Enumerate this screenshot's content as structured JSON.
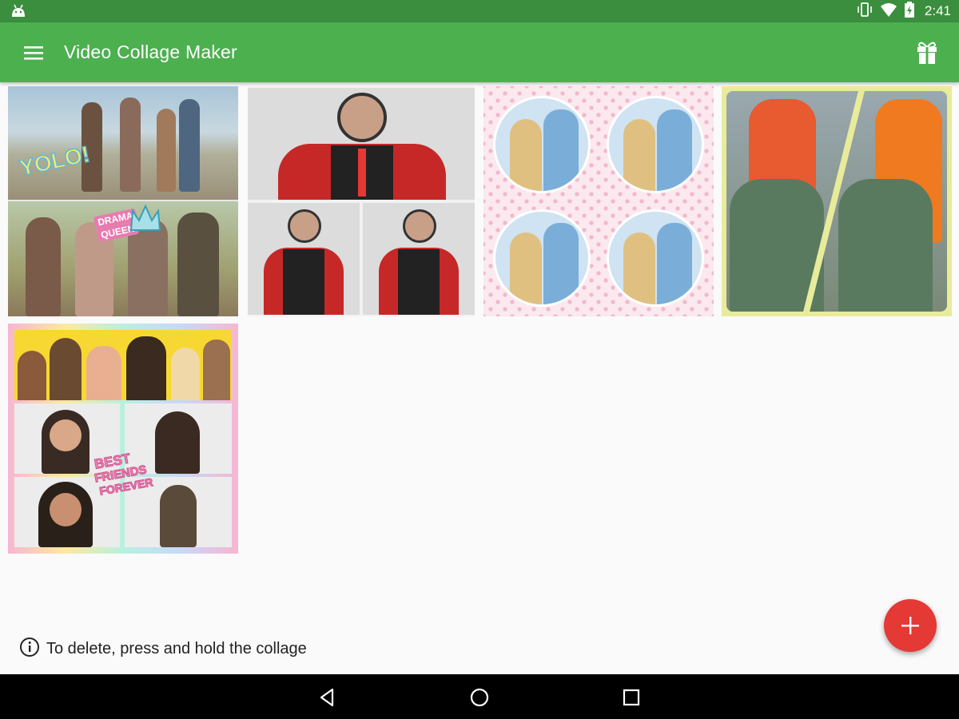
{
  "status_bar": {
    "time": "2:41",
    "icons": [
      "android-icon",
      "vibrate-icon",
      "wifi-icon",
      "battery-charging-icon"
    ]
  },
  "toolbar": {
    "title": "Video Collage Maker",
    "menu_icon": "hamburger-menu-icon",
    "gift_icon": "gift-icon"
  },
  "collages": [
    {
      "layout": "two-row",
      "stickers": [
        "YOLO!",
        "DRAMA",
        "QUEEN"
      ]
    },
    {
      "layout": "one-over-two"
    },
    {
      "layout": "four-circles"
    },
    {
      "layout": "diagonal-split"
    },
    {
      "layout": "three-row",
      "stickers": [
        "BEST",
        "FRIENDS",
        "FOREVER"
      ]
    }
  ],
  "hint": {
    "text": "To delete, press and hold the collage",
    "icon": "info-icon"
  },
  "fab": {
    "icon": "plus-icon"
  },
  "nav_bar": {
    "icons": [
      "back-icon",
      "home-icon",
      "recents-icon"
    ]
  },
  "colors": {
    "status_bar": "#3b8e3e",
    "toolbar": "#4cb04f",
    "fab": "#e53935",
    "background": "#fafafa"
  }
}
